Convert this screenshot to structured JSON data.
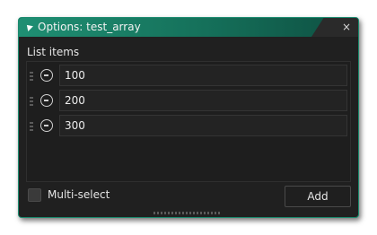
{
  "window": {
    "title": "Options: test_array",
    "close_glyph": "×",
    "accent_color": "#1a8a6e"
  },
  "list": {
    "label": "List items",
    "items": [
      {
        "value": "100",
        "remove_icon": "minus-circle-icon"
      },
      {
        "value": "200",
        "remove_icon": "minus-circle-icon"
      },
      {
        "value": "300",
        "remove_icon": "minus-circle-icon"
      }
    ]
  },
  "footer": {
    "multiselect_label": "Multi-select",
    "multiselect_checked": false,
    "add_label": "Add"
  }
}
